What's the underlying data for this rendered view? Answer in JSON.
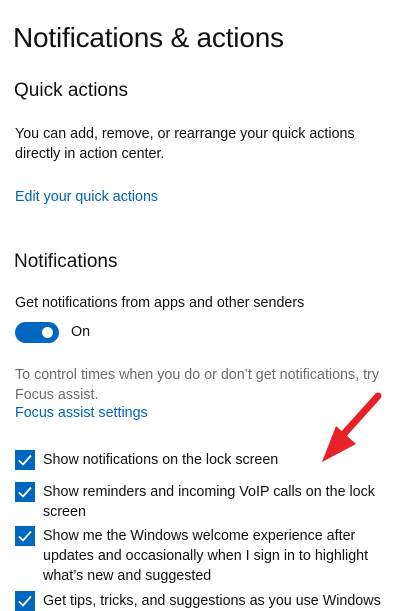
{
  "page": {
    "title": "Notifications & actions"
  },
  "quick_actions": {
    "heading": "Quick actions",
    "description": "You can add, remove, or rearrange your quick actions directly in action center.",
    "edit_link": "Edit your quick actions"
  },
  "notifications": {
    "heading": "Notifications",
    "get_notifications_label": "Get notifications from apps and other senders",
    "toggle_state": "On",
    "focus_text": "To control times when you do or don’t get notifications, try Focus assist.",
    "focus_link": "Focus assist settings",
    "checkboxes": [
      {
        "label": "Show notifications on the lock screen",
        "checked": true
      },
      {
        "label": "Show reminders and incoming VoIP calls on the lock screen",
        "checked": true
      },
      {
        "label": "Show me the Windows welcome experience after updates and occasionally when I sign in to highlight what’s new and suggested",
        "checked": true
      },
      {
        "label": "Get tips, tricks, and suggestions as you use Windows",
        "checked": true
      }
    ]
  },
  "colors": {
    "accent": "#0067c0",
    "link": "#0063b1",
    "annotation_arrow": "#e8202a"
  },
  "icons": {
    "checkbox_mark": "check-icon",
    "annotation": "red-arrow-icon"
  }
}
